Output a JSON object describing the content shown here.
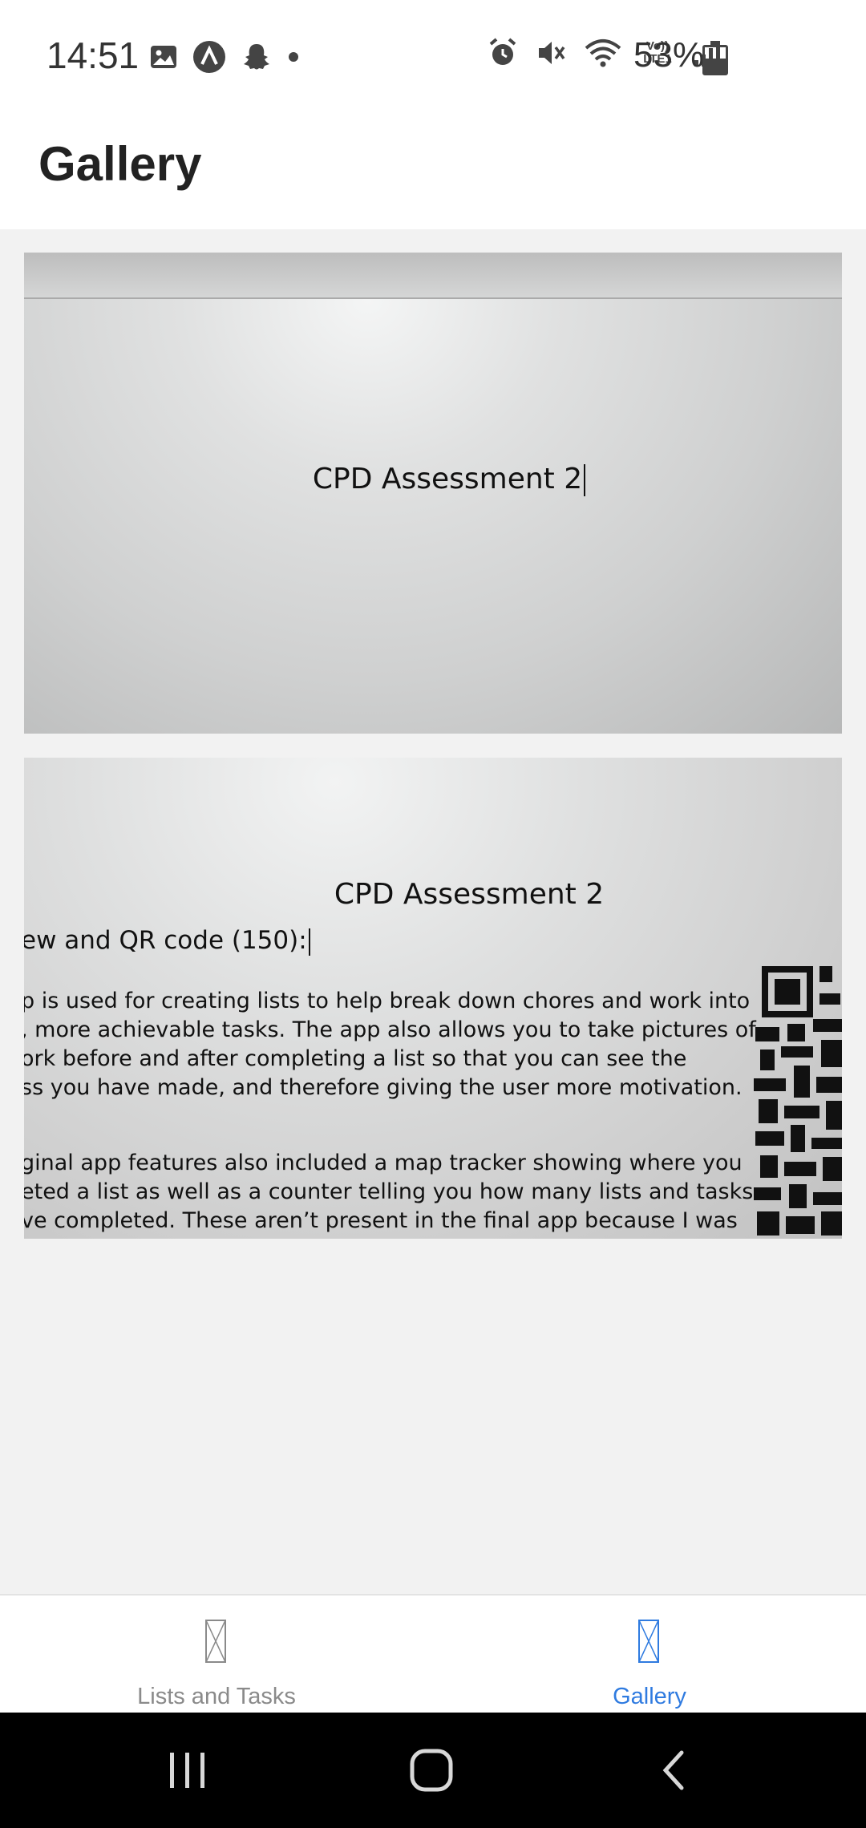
{
  "status_bar": {
    "time": "14:51",
    "battery_percent": "53%",
    "left_icons": [
      "image-icon",
      "app-a-icon",
      "snapchat-icon",
      "dot-icon"
    ],
    "right_icons": [
      "alarm-icon",
      "mute-icon",
      "wifi-icon",
      "volte-icon",
      "signal-icon",
      "battery-icon"
    ],
    "volte_label": "Vo)) LTE1"
  },
  "app_bar": {
    "title": "Gallery"
  },
  "gallery": {
    "photos": [
      {
        "title": "CPD Assessment 2"
      },
      {
        "title": "CPD Assessment 2",
        "subheading": "ew and QR code (150):",
        "paragraph1": [
          "p is used for creating lists to help break down chores and work into",
          ", more achievable tasks. The app also allows you to take pictures of",
          "ork before and after completing a list so that you can see the",
          "ss you have made, and therefore giving the user more motivation."
        ],
        "paragraph2": [
          "ginal app features also included a map tracker showing where you",
          "eted a list as well as a counter telling you how many lists and tasks",
          "ve completed. These aren’t present in the final app because I was"
        ]
      }
    ]
  },
  "bottom_nav": {
    "items": [
      {
        "label": "Lists and Tasks",
        "active": false
      },
      {
        "label": "Gallery",
        "active": true
      }
    ],
    "active_color": "#2f7be0",
    "inactive_color": "#8a8a8a"
  },
  "system_nav": {
    "buttons": [
      "recents-icon",
      "home-icon",
      "back-icon"
    ]
  }
}
